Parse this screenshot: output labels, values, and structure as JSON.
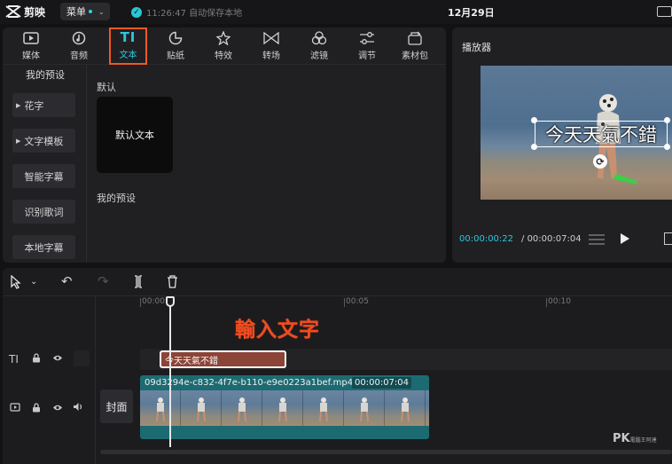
{
  "app": {
    "name": "剪映",
    "menu_label": "菜单",
    "save_status": "11:26:47 自动保存本地",
    "date": "12月29日"
  },
  "toolbar": {
    "items": [
      {
        "label": "媒体",
        "icon": "media-icon"
      },
      {
        "label": "音频",
        "icon": "audio-icon"
      },
      {
        "label": "文本",
        "icon": "text-icon",
        "glyph": "TI",
        "active": true
      },
      {
        "label": "贴纸",
        "icon": "sticker-icon"
      },
      {
        "label": "特效",
        "icon": "effects-icon"
      },
      {
        "label": "转场",
        "icon": "transition-icon"
      },
      {
        "label": "滤镜",
        "icon": "filter-icon"
      },
      {
        "label": "调节",
        "icon": "adjust-icon"
      },
      {
        "label": "素材包",
        "icon": "material-pack-icon"
      }
    ]
  },
  "sidebar": {
    "title": "我的预设",
    "items": [
      {
        "label": "花字",
        "expandable": true
      },
      {
        "label": "文字模板",
        "expandable": true
      },
      {
        "label": "智能字幕",
        "expandable": false
      },
      {
        "label": "识别歌词",
        "expandable": false
      },
      {
        "label": "本地字幕",
        "expandable": false
      }
    ]
  },
  "content": {
    "default_section": "默认",
    "default_card": "默认文本",
    "preset_section": "我的预设"
  },
  "player": {
    "title": "播放器",
    "overlay_text": "今天天氣不錯",
    "current_time": "00:00:00:22",
    "total_time": "00:00:07:04"
  },
  "timeline": {
    "ruler": [
      "00:00",
      "00:05",
      "00:10"
    ],
    "annotation": "輸入文字",
    "text_clip": "今天天氣不錯",
    "video_clip": {
      "name": "09d3294e-c832-4f7e-b110-e9e0223a1bef.mp4",
      "duration": "00:00:07:04"
    },
    "cover_label": "封面",
    "text_track_glyph": "TI"
  },
  "watermark": {
    "main": "PK",
    "sub": "電腦王阿達"
  },
  "colors": {
    "accent": "#2ec7da",
    "highlight": "#ee5a24",
    "annotation": "#f04c1f",
    "text_clip": "#8c4436",
    "video_clip": "#1d6b72"
  }
}
